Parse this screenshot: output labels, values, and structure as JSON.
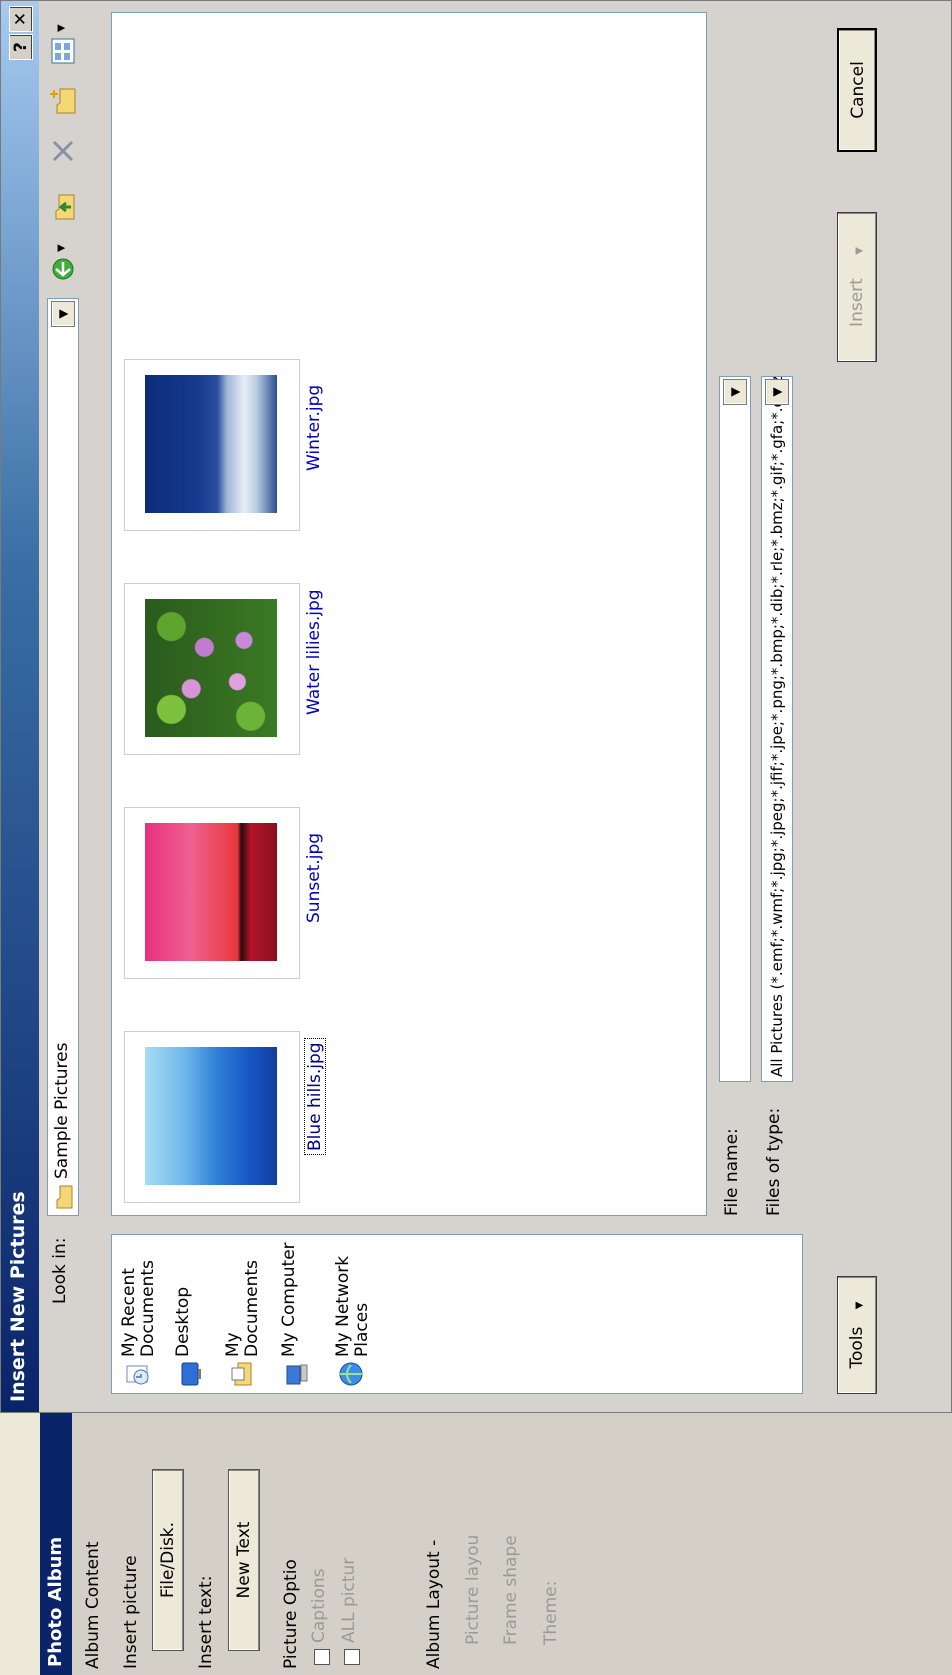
{
  "photo_album": {
    "title": "Photo Album",
    "album_content": "Album Content",
    "insert_picture": "Insert picture",
    "file_disk_button": "File/Disk.",
    "insert_text": "Insert text:",
    "new_text_button": "New Text",
    "picture_options": "Picture Optio",
    "captions": "Captions",
    "all_pictures": "ALL pictur",
    "album_layout": "Album Layout -",
    "picture_layout": "Picture layou",
    "frame_shape": "Frame shape",
    "theme": "Theme:"
  },
  "dialog": {
    "title": "Insert New Pictures",
    "help_button": "?",
    "close_button": "✕"
  },
  "lookin": {
    "label": "Look in:",
    "value": "Sample Pictures"
  },
  "places": [
    {
      "label": "My Recent Documents",
      "icon": "recent-documents-icon"
    },
    {
      "label": "Desktop",
      "icon": "desktop-icon"
    },
    {
      "label": "My Documents",
      "icon": "my-documents-icon"
    },
    {
      "label": "My Computer",
      "icon": "my-computer-icon"
    },
    {
      "label": "My Network Places",
      "icon": "network-places-icon"
    }
  ],
  "files": [
    {
      "name": "Blue hills.jpg",
      "selected": true
    },
    {
      "name": "Sunset.jpg",
      "selected": false
    },
    {
      "name": "Water lilies.jpg",
      "selected": false
    },
    {
      "name": "Winter.jpg",
      "selected": false
    }
  ],
  "filename": {
    "label": "File name:",
    "value": ""
  },
  "filetype": {
    "label": "Files of type:",
    "value": "All Pictures (*.emf;*.wmf;*.jpg;*.jpeg;*.jfif;*.jpe;*.png;*.bmp;*.dib;*.rle;*.bmz;*.gif;*.gfa;*.emz"
  },
  "buttons": {
    "tools": "Tools",
    "insert": "Insert",
    "cancel": "Cancel"
  },
  "colors": {
    "titlebar": "#0a246a",
    "link_text": "#0000c0",
    "dialog_bg": "#d6d3ce"
  }
}
